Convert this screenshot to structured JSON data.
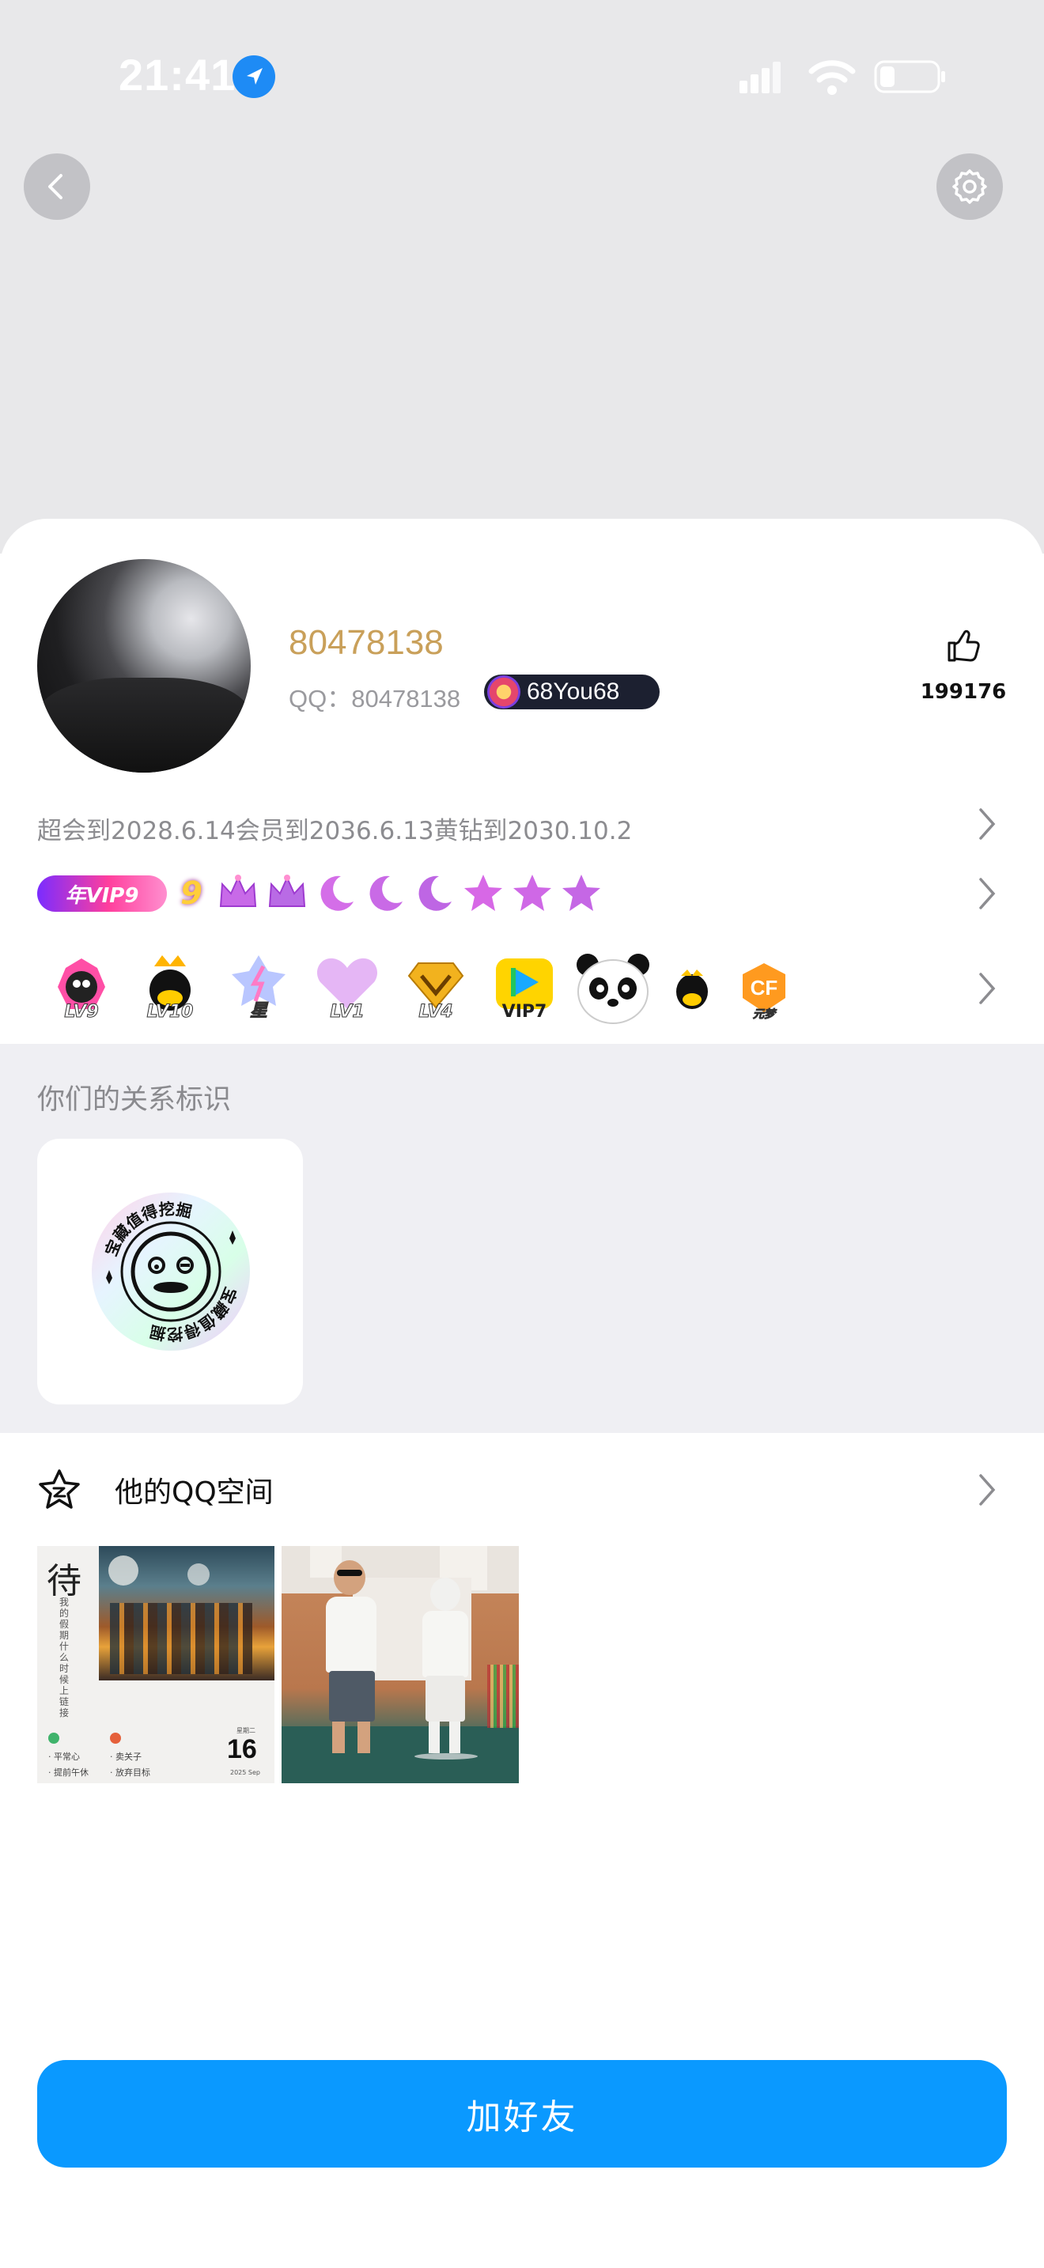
{
  "status_bar": {
    "time": "21:41"
  },
  "profile": {
    "nickname": "80478138",
    "qq_label": "QQ：80478138",
    "pill_text": "68You68",
    "like_count": "199176",
    "vip_text": "超会到2028.6.14会员到2036.6.13黄钻到2030.10.2",
    "year_vip_label": "年VIP9"
  },
  "level_badges": [
    {
      "label": "LV9"
    },
    {
      "label": "LV10"
    },
    {
      "label": "星"
    },
    {
      "label": "LV1"
    },
    {
      "label": "LV4"
    },
    {
      "label": "VIP7"
    },
    {
      "label": ""
    },
    {
      "label": ""
    },
    {
      "label": "元梦"
    }
  ],
  "relationship": {
    "title": "你们的关系标识",
    "medal_text": "宝藏值得挖掘"
  },
  "qzone": {
    "title": "他的QQ空间",
    "photo1": {
      "char": "待",
      "vertical": "我的假期什么时候上链接",
      "items": [
        "平常心",
        "卖关子",
        "提前午休",
        "放弃目标"
      ],
      "weekday": "星期二",
      "day": "16",
      "date": "2025 Sep"
    }
  },
  "actions": {
    "add_friend": "加好友"
  },
  "colors": {
    "accent": "#0a99ff",
    "nickname": "#c9a05a"
  }
}
